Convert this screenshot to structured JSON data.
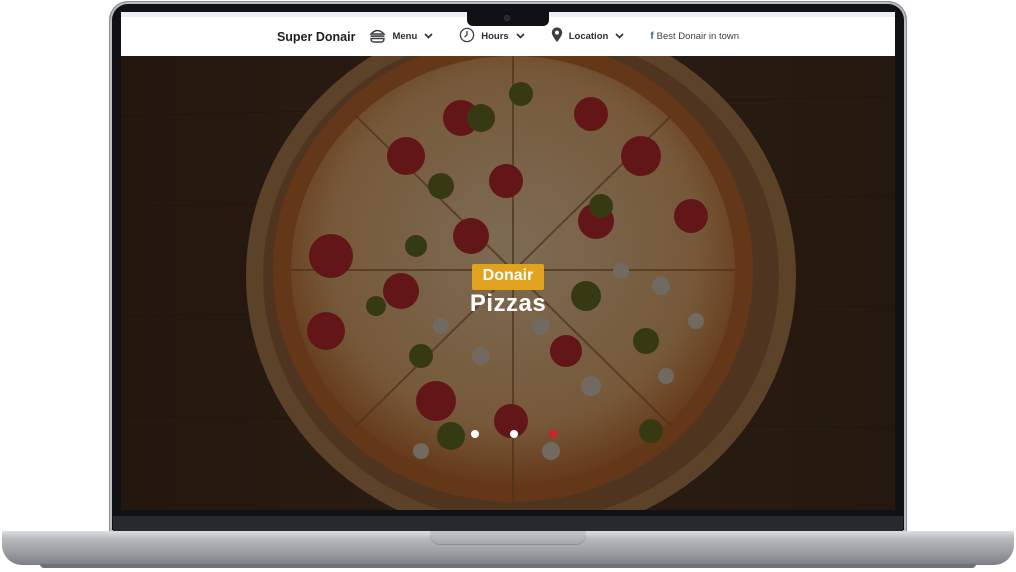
{
  "header": {
    "brand": "Super Donair",
    "nav": [
      {
        "label": "Menu",
        "icon": "burger-icon"
      },
      {
        "label": "Hours",
        "icon": "clock-icon"
      },
      {
        "label": "Location",
        "icon": "map-pin-icon"
      }
    ],
    "social": {
      "icon": "facebook-icon",
      "label": "Best Donair in town"
    }
  },
  "hero": {
    "badge": "Donair",
    "title": "Pizzas",
    "slides": 3,
    "active_slide": 3,
    "active_dot_color": "#d11f2c",
    "dot_color": "#ffffff",
    "badge_color": "#e0a21f"
  }
}
